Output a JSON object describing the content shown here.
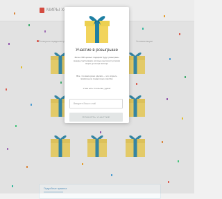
{
  "header": {
    "logo_text": "МИРЫ ХОББИ"
  },
  "subheader": {
    "left_text": "Розыгрыш подарков среди участников",
    "right_text": "Условия акции"
  },
  "modal": {
    "title": "Участие в розыгрыше",
    "description": "Более 300 ценных подарков будут разыграны между участниками, которые выполнят условия акции до конца месяца.",
    "note": "Все, что вам нужно сделать – это открыть правильную подарочную коробку.",
    "attempts": "У вас есть 3 попытки, удачи!",
    "email_placeholder": "Введите Ваш e-mail",
    "button_label": "ПРИНЯТЬ УЧАСТИЕ"
  },
  "bottom_panel": {
    "text": "Подробные правила"
  },
  "colors": {
    "brand_red": "#e0392b",
    "gift_yellow": "#f2d45c",
    "ribbon_teal": "#1e7fa3",
    "button_disabled_bg": "#e3e6e6"
  },
  "icons": {
    "gift": "gift-box-icon",
    "logo": "brand-logo-icon"
  },
  "gift_grid": {
    "count": 9
  }
}
